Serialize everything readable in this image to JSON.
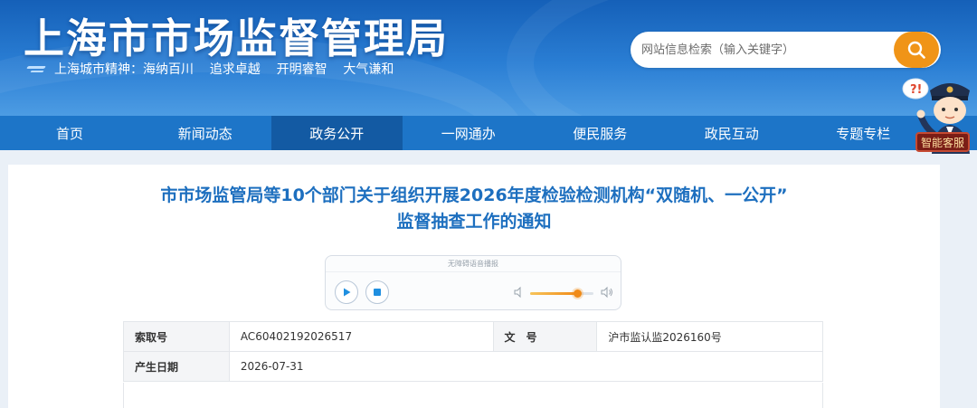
{
  "header": {
    "site_title": "上海市市场监督管理局",
    "motto": "上海城市精神：海纳百川    追求卓越    开明睿智    大气谦和",
    "search_placeholder": "网站信息检索（输入关键字）"
  },
  "nav": {
    "items": [
      {
        "label": "首页",
        "active": false
      },
      {
        "label": "新闻动态",
        "active": false
      },
      {
        "label": "政务公开",
        "active": true
      },
      {
        "label": "一网通办",
        "active": false
      },
      {
        "label": "便民服务",
        "active": false
      },
      {
        "label": "政民互动",
        "active": false
      },
      {
        "label": "专题专栏",
        "active": false
      }
    ]
  },
  "mascot": {
    "badge": "智能客服"
  },
  "article": {
    "title_line1": "市市场监管局等10个部门关于组织开展2026年度检验检测机构“双随机、一公开”",
    "title_line2": "监督抽查工作的通知"
  },
  "player": {
    "caption": "无障碍语音播报",
    "volume_fraction": 0.75
  },
  "meta": {
    "index_label": "索取号",
    "index_value": "AC60402192026517",
    "doc_label": "文　号",
    "doc_value": "沪市监认监2026160号",
    "date_label": "产生日期",
    "date_value": "2026-07-31"
  },
  "colors": {
    "nav_bg": "#1d75c8",
    "nav_active": "#135aa3",
    "title_blue": "#1d6fbf",
    "search_orange": "#f09417"
  }
}
